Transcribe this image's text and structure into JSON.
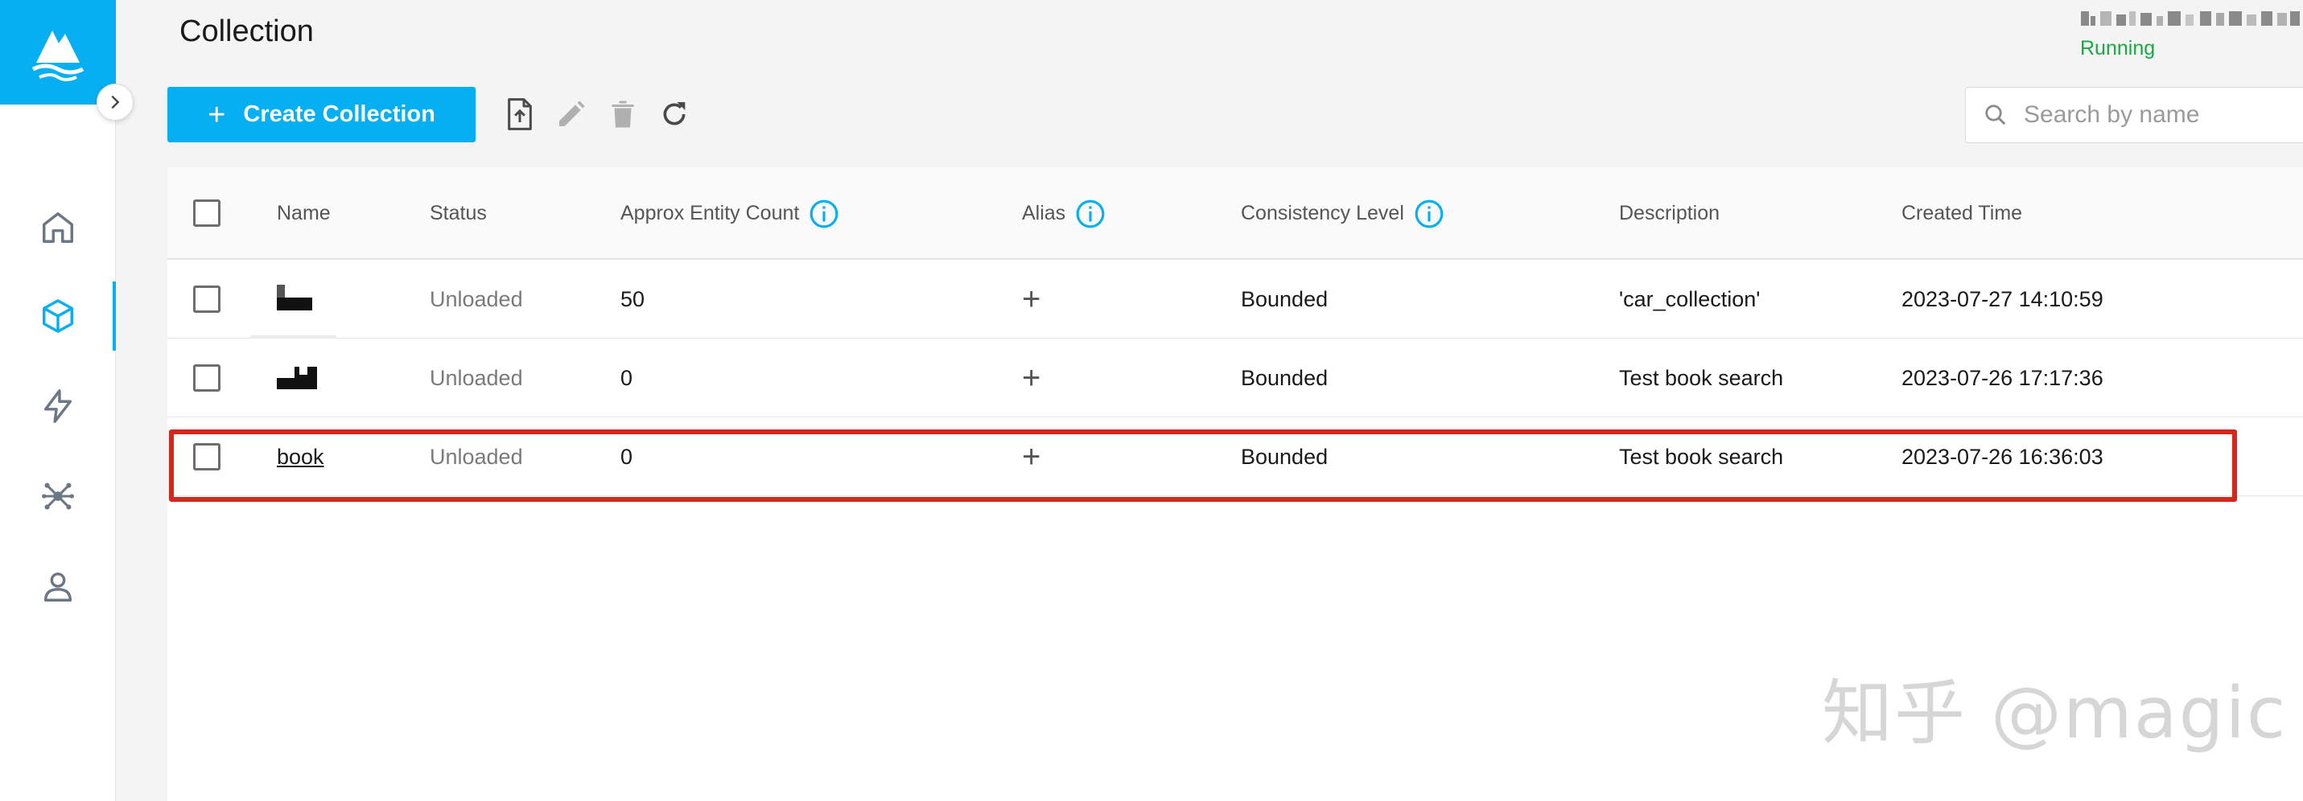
{
  "header": {
    "title": "Collection",
    "server_status": "Running"
  },
  "toolbar": {
    "create_label": "Create Collection",
    "search_placeholder": "Search by name",
    "icons": [
      "import-icon",
      "edit-icon",
      "delete-icon",
      "refresh-icon"
    ]
  },
  "sidebar": {
    "items": [
      "home-icon",
      "collection-icon",
      "system-icon",
      "topology-icon",
      "user-icon"
    ],
    "active": "collection-icon"
  },
  "table": {
    "columns": {
      "name": "Name",
      "status": "Status",
      "entity_count": "Approx Entity Count",
      "alias": "Alias",
      "consistency": "Consistency Level",
      "description": "Description",
      "created": "Created Time"
    },
    "rows": [
      {
        "name": "",
        "status": "Unloaded",
        "entity_count": "50",
        "alias": "+",
        "consistency": "Bounded",
        "description": "'car_collection'",
        "created": "2023-07-27 14:10:59"
      },
      {
        "name": "",
        "status": "Unloaded",
        "entity_count": "0",
        "alias": "+",
        "consistency": "Bounded",
        "description": "Test book search",
        "created": "2023-07-26 17:17:36"
      },
      {
        "name": "book",
        "status": "Unloaded",
        "entity_count": "0",
        "alias": "+",
        "consistency": "Bounded",
        "description": "Test book search",
        "created": "2023-07-26 16:36:03"
      }
    ]
  },
  "colors": {
    "accent": "#06aff2",
    "running": "#1ba843",
    "highlight": "#d7261e"
  },
  "watermark": "知乎 @magic"
}
